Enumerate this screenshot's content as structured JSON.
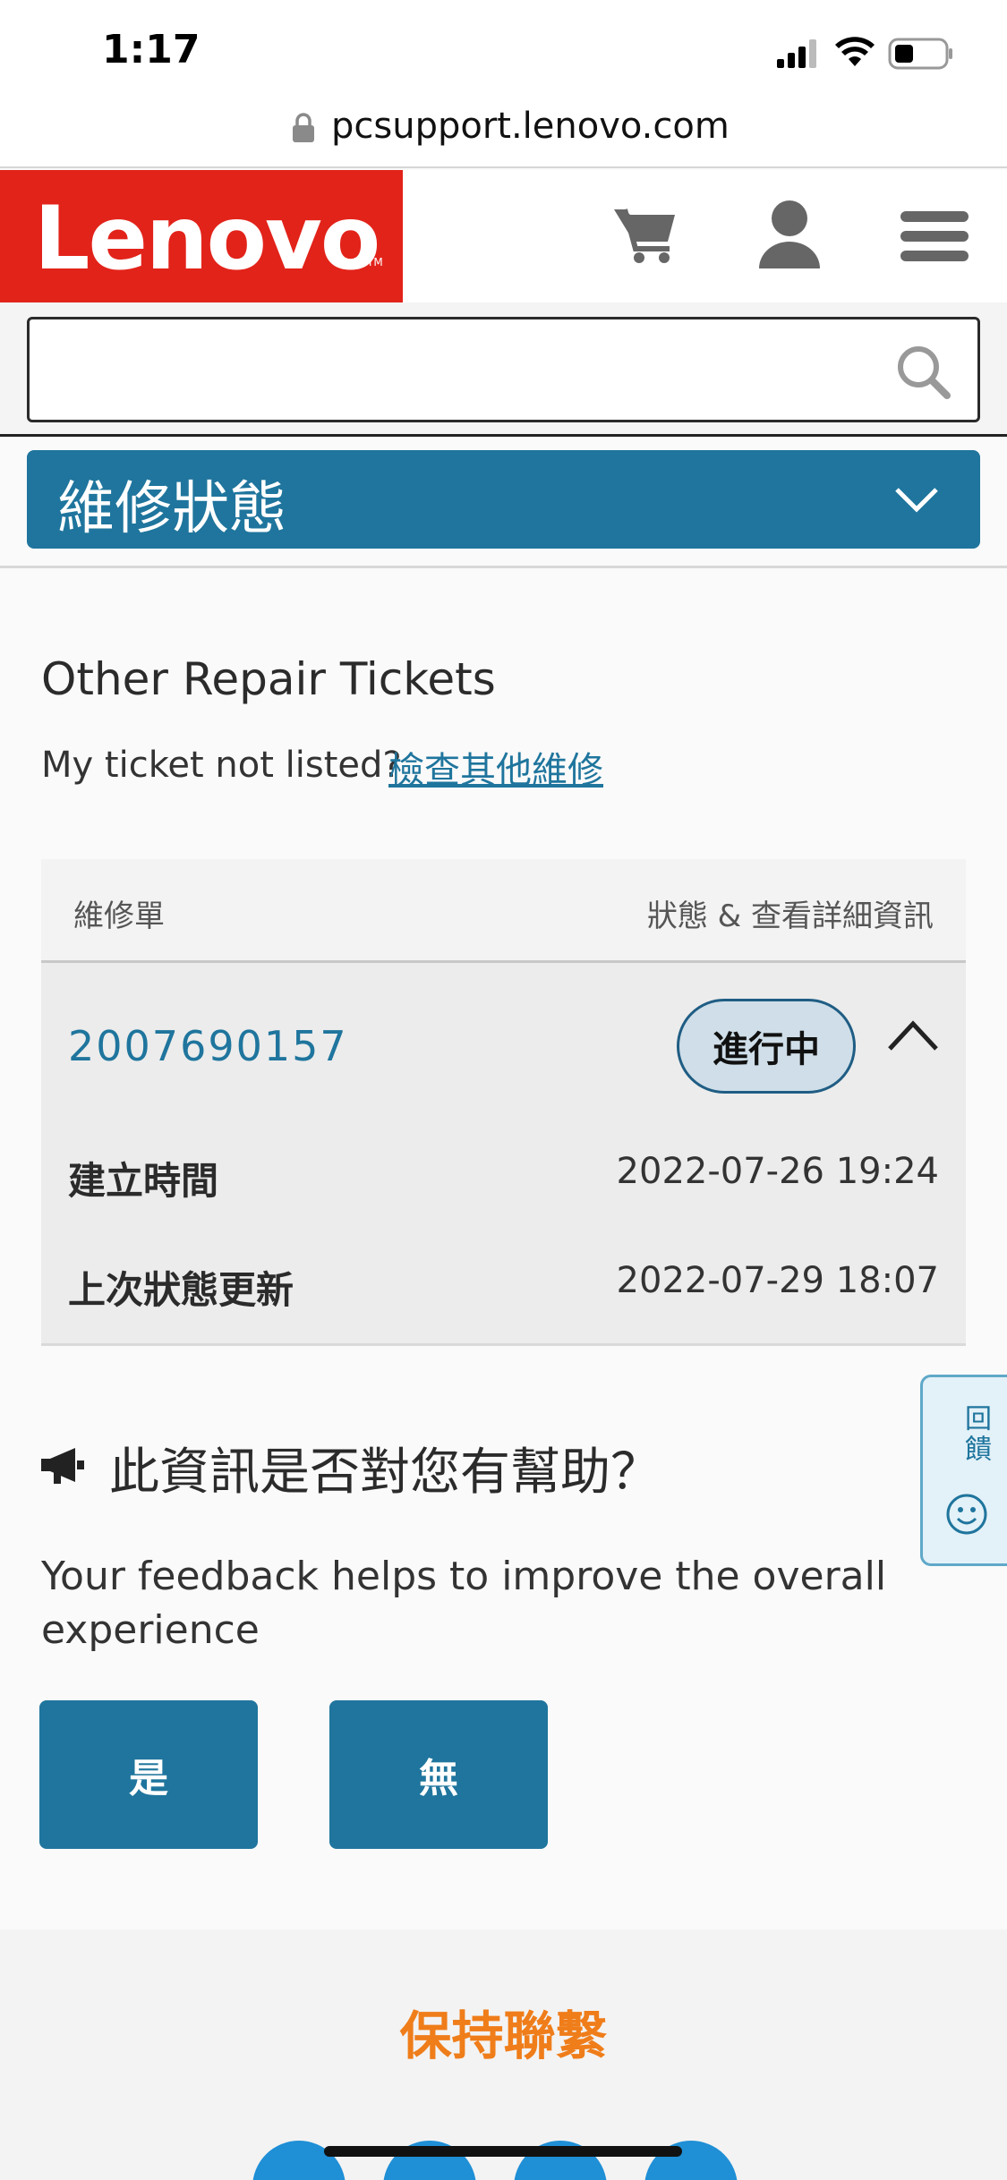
{
  "status_bar": {
    "time": "1:17"
  },
  "browser": {
    "url": "pcsupport.lenovo.com"
  },
  "header": {
    "logo_text": "Lenovo",
    "logo_tm": "TM"
  },
  "search": {
    "placeholder": ""
  },
  "section": {
    "title": "維修狀態"
  },
  "other_tickets": {
    "title": "Other Repair Tickets",
    "not_listed_text": "My ticket not listed?",
    "check_link": "檢查其他維修"
  },
  "table": {
    "col_ticket": "維修單",
    "col_status": "狀態 & 查看詳細資訊",
    "tickets": [
      {
        "number": "2007690157",
        "status": "進行中",
        "created_label": "建立時間",
        "created_value": "2022-07-26 19:24",
        "updated_label": "上次狀態更新",
        "updated_value": "2022-07-29 18:07"
      }
    ]
  },
  "feedback": {
    "title": "此資訊是否對您有幫助？",
    "text": "Your feedback helps to improve the overall experience",
    "yes_label": "是",
    "no_label": "無",
    "side_tab_label": "回饋"
  },
  "footer": {
    "title": "保持聯繫"
  },
  "colors": {
    "brand_red": "#e2231a",
    "primary_blue": "#1f759d",
    "accent_orange": "#ef7d1a"
  }
}
